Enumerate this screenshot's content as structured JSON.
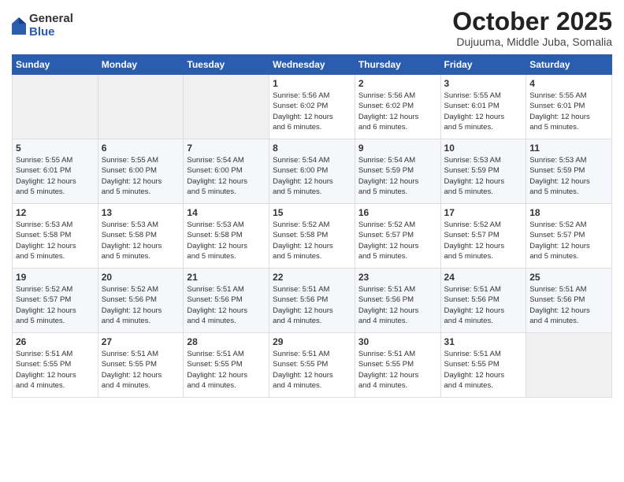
{
  "logo": {
    "general": "General",
    "blue": "Blue"
  },
  "title": "October 2025",
  "subtitle": "Dujuuma, Middle Juba, Somalia",
  "days_of_week": [
    "Sunday",
    "Monday",
    "Tuesday",
    "Wednesday",
    "Thursday",
    "Friday",
    "Saturday"
  ],
  "weeks": [
    [
      {
        "day": "",
        "info": ""
      },
      {
        "day": "",
        "info": ""
      },
      {
        "day": "",
        "info": ""
      },
      {
        "day": "1",
        "info": "Sunrise: 5:56 AM\nSunset: 6:02 PM\nDaylight: 12 hours\nand 6 minutes."
      },
      {
        "day": "2",
        "info": "Sunrise: 5:56 AM\nSunset: 6:02 PM\nDaylight: 12 hours\nand 6 minutes."
      },
      {
        "day": "3",
        "info": "Sunrise: 5:55 AM\nSunset: 6:01 PM\nDaylight: 12 hours\nand 5 minutes."
      },
      {
        "day": "4",
        "info": "Sunrise: 5:55 AM\nSunset: 6:01 PM\nDaylight: 12 hours\nand 5 minutes."
      }
    ],
    [
      {
        "day": "5",
        "info": "Sunrise: 5:55 AM\nSunset: 6:01 PM\nDaylight: 12 hours\nand 5 minutes."
      },
      {
        "day": "6",
        "info": "Sunrise: 5:55 AM\nSunset: 6:00 PM\nDaylight: 12 hours\nand 5 minutes."
      },
      {
        "day": "7",
        "info": "Sunrise: 5:54 AM\nSunset: 6:00 PM\nDaylight: 12 hours\nand 5 minutes."
      },
      {
        "day": "8",
        "info": "Sunrise: 5:54 AM\nSunset: 6:00 PM\nDaylight: 12 hours\nand 5 minutes."
      },
      {
        "day": "9",
        "info": "Sunrise: 5:54 AM\nSunset: 5:59 PM\nDaylight: 12 hours\nand 5 minutes."
      },
      {
        "day": "10",
        "info": "Sunrise: 5:53 AM\nSunset: 5:59 PM\nDaylight: 12 hours\nand 5 minutes."
      },
      {
        "day": "11",
        "info": "Sunrise: 5:53 AM\nSunset: 5:59 PM\nDaylight: 12 hours\nand 5 minutes."
      }
    ],
    [
      {
        "day": "12",
        "info": "Sunrise: 5:53 AM\nSunset: 5:58 PM\nDaylight: 12 hours\nand 5 minutes."
      },
      {
        "day": "13",
        "info": "Sunrise: 5:53 AM\nSunset: 5:58 PM\nDaylight: 12 hours\nand 5 minutes."
      },
      {
        "day": "14",
        "info": "Sunrise: 5:53 AM\nSunset: 5:58 PM\nDaylight: 12 hours\nand 5 minutes."
      },
      {
        "day": "15",
        "info": "Sunrise: 5:52 AM\nSunset: 5:58 PM\nDaylight: 12 hours\nand 5 minutes."
      },
      {
        "day": "16",
        "info": "Sunrise: 5:52 AM\nSunset: 5:57 PM\nDaylight: 12 hours\nand 5 minutes."
      },
      {
        "day": "17",
        "info": "Sunrise: 5:52 AM\nSunset: 5:57 PM\nDaylight: 12 hours\nand 5 minutes."
      },
      {
        "day": "18",
        "info": "Sunrise: 5:52 AM\nSunset: 5:57 PM\nDaylight: 12 hours\nand 5 minutes."
      }
    ],
    [
      {
        "day": "19",
        "info": "Sunrise: 5:52 AM\nSunset: 5:57 PM\nDaylight: 12 hours\nand 5 minutes."
      },
      {
        "day": "20",
        "info": "Sunrise: 5:52 AM\nSunset: 5:56 PM\nDaylight: 12 hours\nand 4 minutes."
      },
      {
        "day": "21",
        "info": "Sunrise: 5:51 AM\nSunset: 5:56 PM\nDaylight: 12 hours\nand 4 minutes."
      },
      {
        "day": "22",
        "info": "Sunrise: 5:51 AM\nSunset: 5:56 PM\nDaylight: 12 hours\nand 4 minutes."
      },
      {
        "day": "23",
        "info": "Sunrise: 5:51 AM\nSunset: 5:56 PM\nDaylight: 12 hours\nand 4 minutes."
      },
      {
        "day": "24",
        "info": "Sunrise: 5:51 AM\nSunset: 5:56 PM\nDaylight: 12 hours\nand 4 minutes."
      },
      {
        "day": "25",
        "info": "Sunrise: 5:51 AM\nSunset: 5:56 PM\nDaylight: 12 hours\nand 4 minutes."
      }
    ],
    [
      {
        "day": "26",
        "info": "Sunrise: 5:51 AM\nSunset: 5:55 PM\nDaylight: 12 hours\nand 4 minutes."
      },
      {
        "day": "27",
        "info": "Sunrise: 5:51 AM\nSunset: 5:55 PM\nDaylight: 12 hours\nand 4 minutes."
      },
      {
        "day": "28",
        "info": "Sunrise: 5:51 AM\nSunset: 5:55 PM\nDaylight: 12 hours\nand 4 minutes."
      },
      {
        "day": "29",
        "info": "Sunrise: 5:51 AM\nSunset: 5:55 PM\nDaylight: 12 hours\nand 4 minutes."
      },
      {
        "day": "30",
        "info": "Sunrise: 5:51 AM\nSunset: 5:55 PM\nDaylight: 12 hours\nand 4 minutes."
      },
      {
        "day": "31",
        "info": "Sunrise: 5:51 AM\nSunset: 5:55 PM\nDaylight: 12 hours\nand 4 minutes."
      },
      {
        "day": "",
        "info": ""
      }
    ]
  ]
}
